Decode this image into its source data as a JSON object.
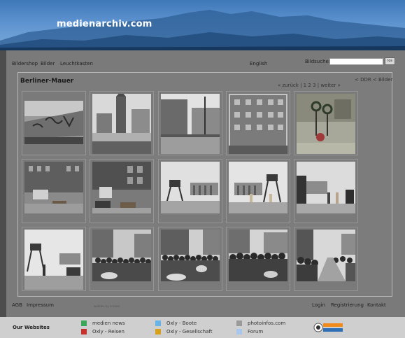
{
  "site": {
    "title": "medienarchiv.com"
  },
  "nav": {
    "items": [
      "Bildershop",
      "Bilder",
      "Leuchtkasten"
    ],
    "language": "English",
    "search_label": "Bildsuche:",
    "search_value": "",
    "search_button": "los"
  },
  "gallery": {
    "title": "Berliner-Mauer",
    "crumb": "< DDR < Bilder",
    "pager": {
      "prev": "« zurück",
      "sep1": "|",
      "p1": "1",
      "p2": "2",
      "p3": "3",
      "sep2": "|",
      "next": "weiter »"
    },
    "thumbnails": [
      {
        "subject": "graffiti-wall"
      },
      {
        "subject": "church-tower-wall"
      },
      {
        "subject": "street-buildings"
      },
      {
        "subject": "apartment-block"
      },
      {
        "subject": "memorial-wreaths"
      },
      {
        "subject": "checkpoint-street"
      },
      {
        "subject": "checkpoint-vehicles"
      },
      {
        "subject": "brandenburg-gate-tower"
      },
      {
        "subject": "brandenburg-gate-guards"
      },
      {
        "subject": "brandenburg-gate-side"
      },
      {
        "subject": "watchtower-gate"
      },
      {
        "subject": "crowd-street"
      },
      {
        "subject": "crowd-cars"
      },
      {
        "subject": "crowd-square"
      },
      {
        "subject": "crowd-road"
      }
    ]
  },
  "footer": {
    "left": [
      "AGB",
      "Impressum"
    ],
    "small": "webdev by e-moss",
    "right": [
      "Login",
      "Registrierung",
      "Kontakt"
    ]
  },
  "websites": {
    "title": "Our Websites",
    "links": [
      {
        "label": "medien news",
        "color": "#3aa85a"
      },
      {
        "label": "Oxly - Reisen",
        "color": "#c8302e"
      },
      {
        "label": "Oxly - Boote",
        "color": "#6ab3e6"
      },
      {
        "label": "Oxly - Gesellschaft",
        "color": "#d6a21e"
      },
      {
        "label": "photoinfos.com",
        "color": "#9a9a9a"
      },
      {
        "label": "Forum",
        "color": "#a9c6ec"
      }
    ],
    "logo": "photoinfos"
  }
}
